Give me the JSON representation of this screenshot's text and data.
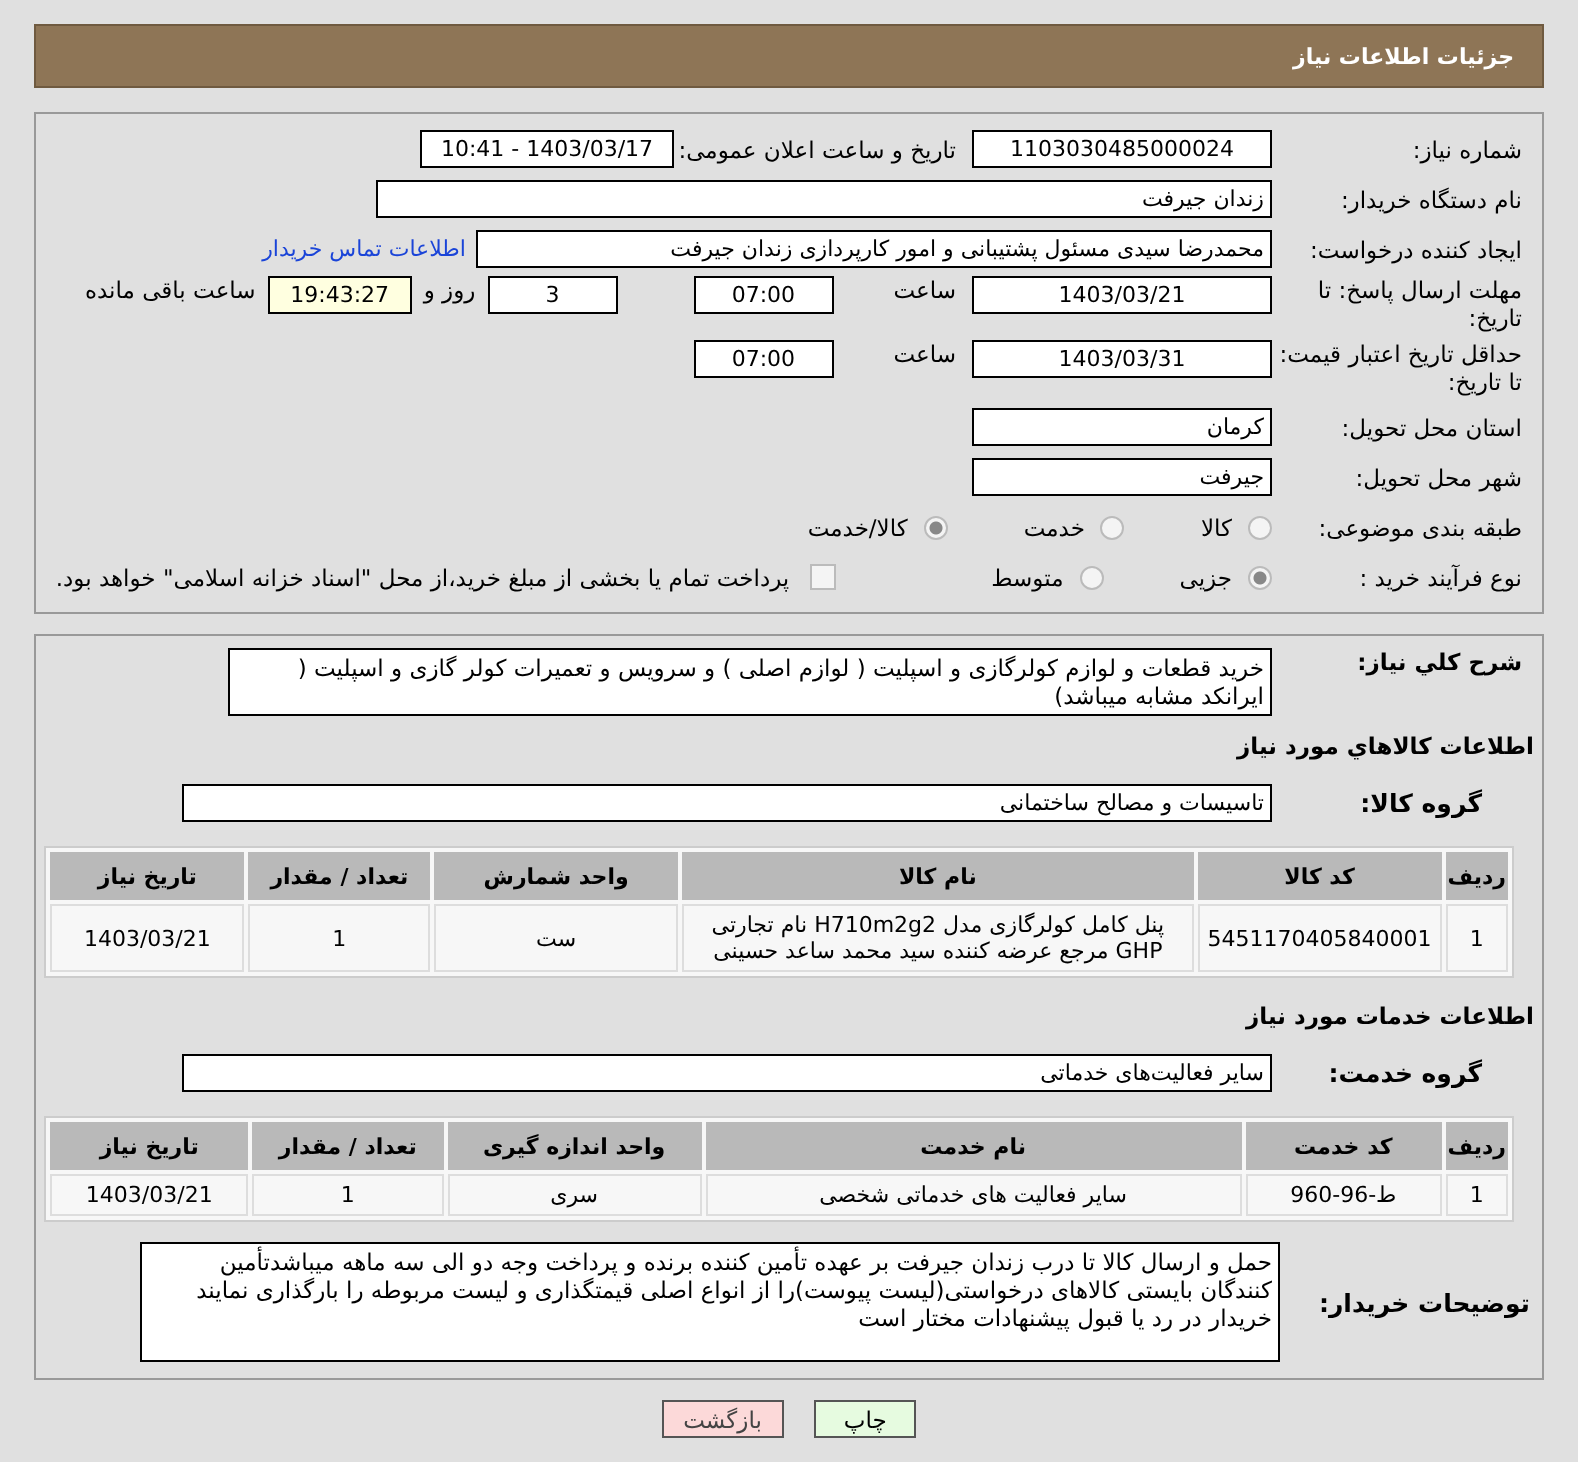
{
  "header": {
    "title": "جزئیات اطلاعات نیاز"
  },
  "need_number": {
    "label": "شماره نیاز:",
    "value": "1103030485000024"
  },
  "announce": {
    "label": "تاریخ و ساعت اعلان عمومی:",
    "value": "1403/03/17 - 10:41"
  },
  "buyer_org": {
    "label": "نام دستگاه خریدار:",
    "value": "زندان جیرفت"
  },
  "requester": {
    "label": "ایجاد کننده درخواست:",
    "value": "محمدرضا سیدی مسئول پشتیبانی و امور کارپردازی زندان جیرفت",
    "link": "اطلاعات تماس خریدار"
  },
  "deadline": {
    "label": "مهلت ارسال پاسخ: تا تاریخ:",
    "date": "1403/03/21",
    "time_label": "ساعت",
    "time": "07:00",
    "days": "3",
    "days_label": "روز و",
    "remaining": "19:43:27",
    "remaining_label": "ساعت باقی مانده"
  },
  "validity": {
    "label": "حداقل تاریخ اعتبار قیمت: تا تاریخ:",
    "date": "1403/03/31",
    "time_label": "ساعت",
    "time": "07:00"
  },
  "province": {
    "label": "استان محل تحویل:",
    "value": "کرمان"
  },
  "city": {
    "label": "شهر محل تحویل:",
    "value": "جیرفت"
  },
  "classification": {
    "label": "طبقه بندی موضوعی:",
    "options": [
      {
        "label": "کالا",
        "selected": false
      },
      {
        "label": "خدمت",
        "selected": false
      },
      {
        "label": "کالا/خدمت",
        "selected": true
      }
    ]
  },
  "purchase_process": {
    "label": "نوع فرآیند خرید :",
    "options": [
      {
        "label": "جزیی",
        "selected": true
      },
      {
        "label": "متوسط",
        "selected": false
      }
    ],
    "payment": {
      "checked": false,
      "label": "پرداخت تمام یا بخشی از مبلغ خرید،از محل \"اسناد خزانه اسلامی\" خواهد بود."
    }
  },
  "description": {
    "label": "شرح كلي نياز:",
    "value": "خرید قطعات و لوازم کولرگازی و اسپلیت ( لوازم اصلی ) و سرویس و تعمیرات کولر گازی و اسپلیت ( ایرانکد مشابه میباشد)"
  },
  "goods": {
    "heading": "اطلاعات كالاهاي مورد نياز",
    "group_label": "گروه کالا:",
    "group": "تاسیسات و مصالح ساختمانی",
    "columns": [
      "ردیف",
      "کد کالا",
      "نام کالا",
      "واحد شمارش",
      "تعداد / مقدار",
      "تاریخ نیاز"
    ],
    "rows": [
      [
        "1",
        "5451170405840001",
        "پنل کامل کولرگازی مدل H710m2g2 نام تجارتی GHP مرجع عرضه کننده سید محمد ساعد حسینی",
        "ست",
        "1",
        "1403/03/21"
      ]
    ]
  },
  "services": {
    "heading": "اطلاعات خدمات مورد نیاز",
    "group_label": "گروه خدمت:",
    "group": "سایر فعالیت‌های خدماتی",
    "columns": [
      "ردیف",
      "کد خدمت",
      "نام خدمت",
      "واحد اندازه گیری",
      "تعداد / مقدار",
      "تاریخ نیاز"
    ],
    "rows": [
      [
        "1",
        "ط-96-960",
        "سایر فعالیت های خدماتی شخصی",
        "سری",
        "1",
        "1403/03/21"
      ]
    ]
  },
  "buyer_notes": {
    "label": "توضیحات خریدار:",
    "value": "حمل و ارسال کالا تا درب زندان جیرفت بر عهده تأمین کننده برنده و پرداخت وجه دو الی سه ماهه میباشدتأمین کنندگان بایستی کالاهای درخواستی(لیست پیوست)را از انواع اصلی قیمتگذاری و لیست مربوطه را بارگذاری نمایند خریدار در رد یا قبول پیشنهادات مختار است"
  },
  "buttons": [
    {
      "kind": "print",
      "label": "چاپ"
    },
    {
      "kind": "back",
      "label": "بازگشت"
    }
  ]
}
